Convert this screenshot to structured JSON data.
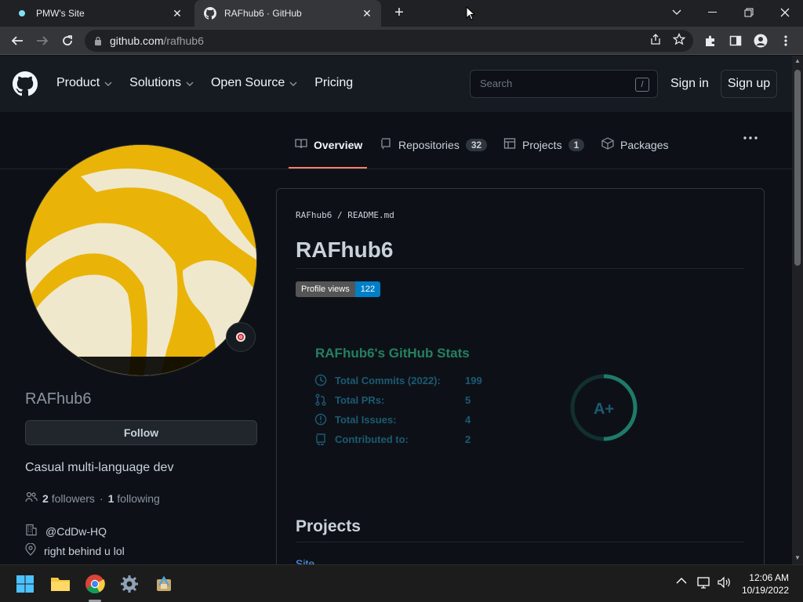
{
  "browser": {
    "tabs": [
      {
        "title": "PMW's Site",
        "favicon": "cyan-dot-icon"
      },
      {
        "title": "RAFhub6 · GitHub",
        "favicon": "github-icon"
      }
    ],
    "url_host": "github.com",
    "url_path": "/rafhub6"
  },
  "header": {
    "nav": [
      "Product",
      "Solutions",
      "Open Source",
      "Pricing"
    ],
    "search_placeholder": "Search",
    "search_key": "/",
    "signin": "Sign in",
    "signup": "Sign up"
  },
  "profile_tabs": [
    {
      "label": "Overview",
      "count": null,
      "active": true
    },
    {
      "label": "Repositories",
      "count": "32"
    },
    {
      "label": "Projects",
      "count": "1"
    },
    {
      "label": "Packages",
      "count": null
    }
  ],
  "sidebar": {
    "username": "RAFhub6",
    "follow_label": "Follow",
    "bio": "Casual multi-language dev",
    "followers_count": "2",
    "followers_label": "followers",
    "separator": "·",
    "following_count": "1",
    "following_label": "following",
    "org": "@CdDw-HQ",
    "location": "right behind u lol"
  },
  "readme": {
    "crumb_user": "RAFhub6",
    "crumb_sep": "/",
    "crumb_file": "README.md",
    "title": "RAFhub6",
    "badge_label": "Profile views",
    "badge_value": "122",
    "stats_title": "RAFhub6's GitHub Stats",
    "stats": [
      {
        "label": "Total Commits (2022):",
        "value": "199",
        "icon": "clock-icon"
      },
      {
        "label": "Total PRs:",
        "value": "5",
        "icon": "pull-request-icon"
      },
      {
        "label": "Total Issues:",
        "value": "4",
        "icon": "issue-icon"
      },
      {
        "label": "Contributed to:",
        "value": "2",
        "icon": "repo-icon"
      }
    ],
    "grade": "A+",
    "projects_heading": "Projects",
    "projects_link": "Site"
  },
  "taskbar": {
    "time": "12:06 AM",
    "date": "10/19/2022"
  },
  "colors": {
    "accent_underline": "#f78166",
    "stats_title": "#25805f",
    "stats_text": "#1c5a73",
    "avatar": "#eab308"
  }
}
